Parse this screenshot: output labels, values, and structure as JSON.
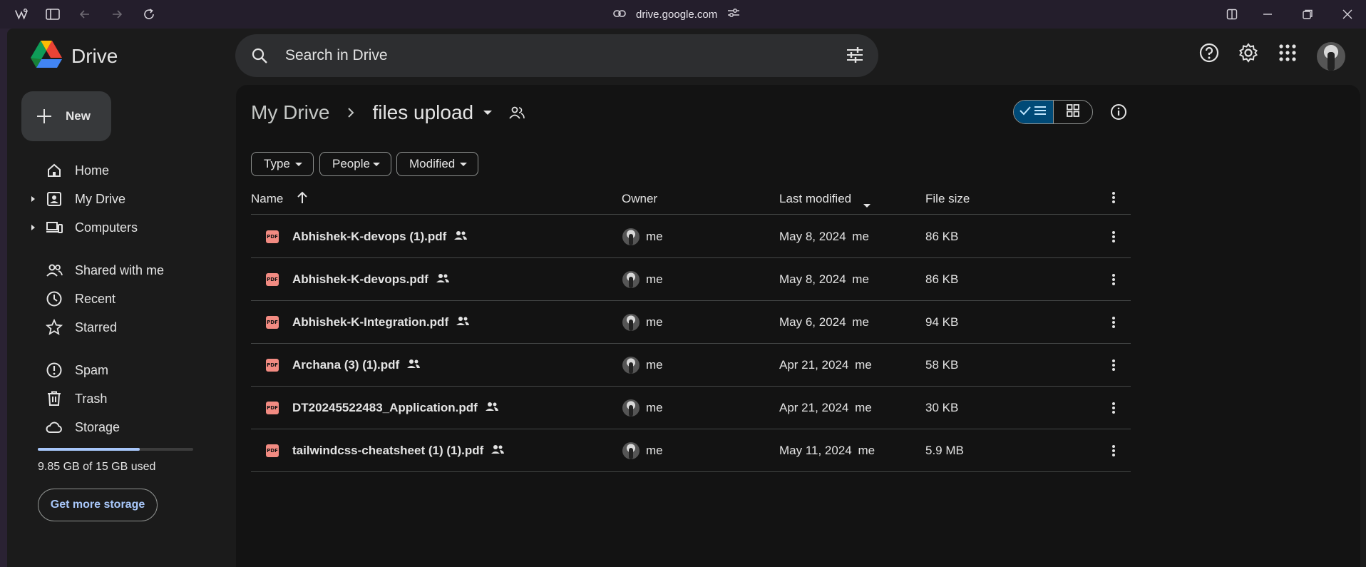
{
  "browser": {
    "url": "drive.google.com"
  },
  "app": {
    "name": "Drive"
  },
  "search": {
    "placeholder": "Search in Drive"
  },
  "new_button": {
    "label": "New"
  },
  "sidebar": {
    "items": [
      {
        "label": "Home",
        "icon": "home-icon"
      },
      {
        "label": "My Drive",
        "icon": "my-drive-icon"
      },
      {
        "label": "Computers",
        "icon": "computers-icon"
      },
      {
        "label": "Shared with me",
        "icon": "shared-icon"
      },
      {
        "label": "Recent",
        "icon": "clock-icon"
      },
      {
        "label": "Starred",
        "icon": "star-icon"
      },
      {
        "label": "Spam",
        "icon": "spam-icon"
      },
      {
        "label": "Trash",
        "icon": "trash-icon"
      },
      {
        "label": "Storage",
        "icon": "cloud-icon"
      }
    ],
    "storage_used_fraction": 0.657,
    "storage_text": "9.85 GB of 15 GB used",
    "get_storage_label": "Get more storage"
  },
  "breadcrumb": {
    "root": "My Drive",
    "current": "files upload"
  },
  "filters": {
    "type": "Type",
    "people": "People",
    "modified": "Modified"
  },
  "table": {
    "headers": {
      "name": "Name",
      "owner": "Owner",
      "last_modified": "Last modified",
      "file_size": "File size"
    },
    "rows": [
      {
        "name": "Abhishek-K-devops (1).pdf",
        "owner": "me",
        "modified": "May 8, 2024",
        "modified_by": "me",
        "size": "86 KB"
      },
      {
        "name": "Abhishek-K-devops.pdf",
        "owner": "me",
        "modified": "May 8, 2024",
        "modified_by": "me",
        "size": "86 KB"
      },
      {
        "name": "Abhishek-K-Integration.pdf",
        "owner": "me",
        "modified": "May 6, 2024",
        "modified_by": "me",
        "size": "94 KB"
      },
      {
        "name": "Archana (3) (1).pdf",
        "owner": "me",
        "modified": "Apr 21, 2024",
        "modified_by": "me",
        "size": "58 KB"
      },
      {
        "name": "DT20245522483_Application.pdf",
        "owner": "me",
        "modified": "Apr 21, 2024",
        "modified_by": "me",
        "size": "30 KB"
      },
      {
        "name": "tailwindcss-cheatsheet (1) (1).pdf",
        "owner": "me",
        "modified": "May 11, 2024",
        "modified_by": "me",
        "size": "5.9 MB"
      }
    ],
    "file_type_icon_label": "PDF"
  },
  "colors": {
    "accent": "#a8c7fa",
    "selected_view": "#004a77",
    "pdf_icon": "#f28b82"
  }
}
